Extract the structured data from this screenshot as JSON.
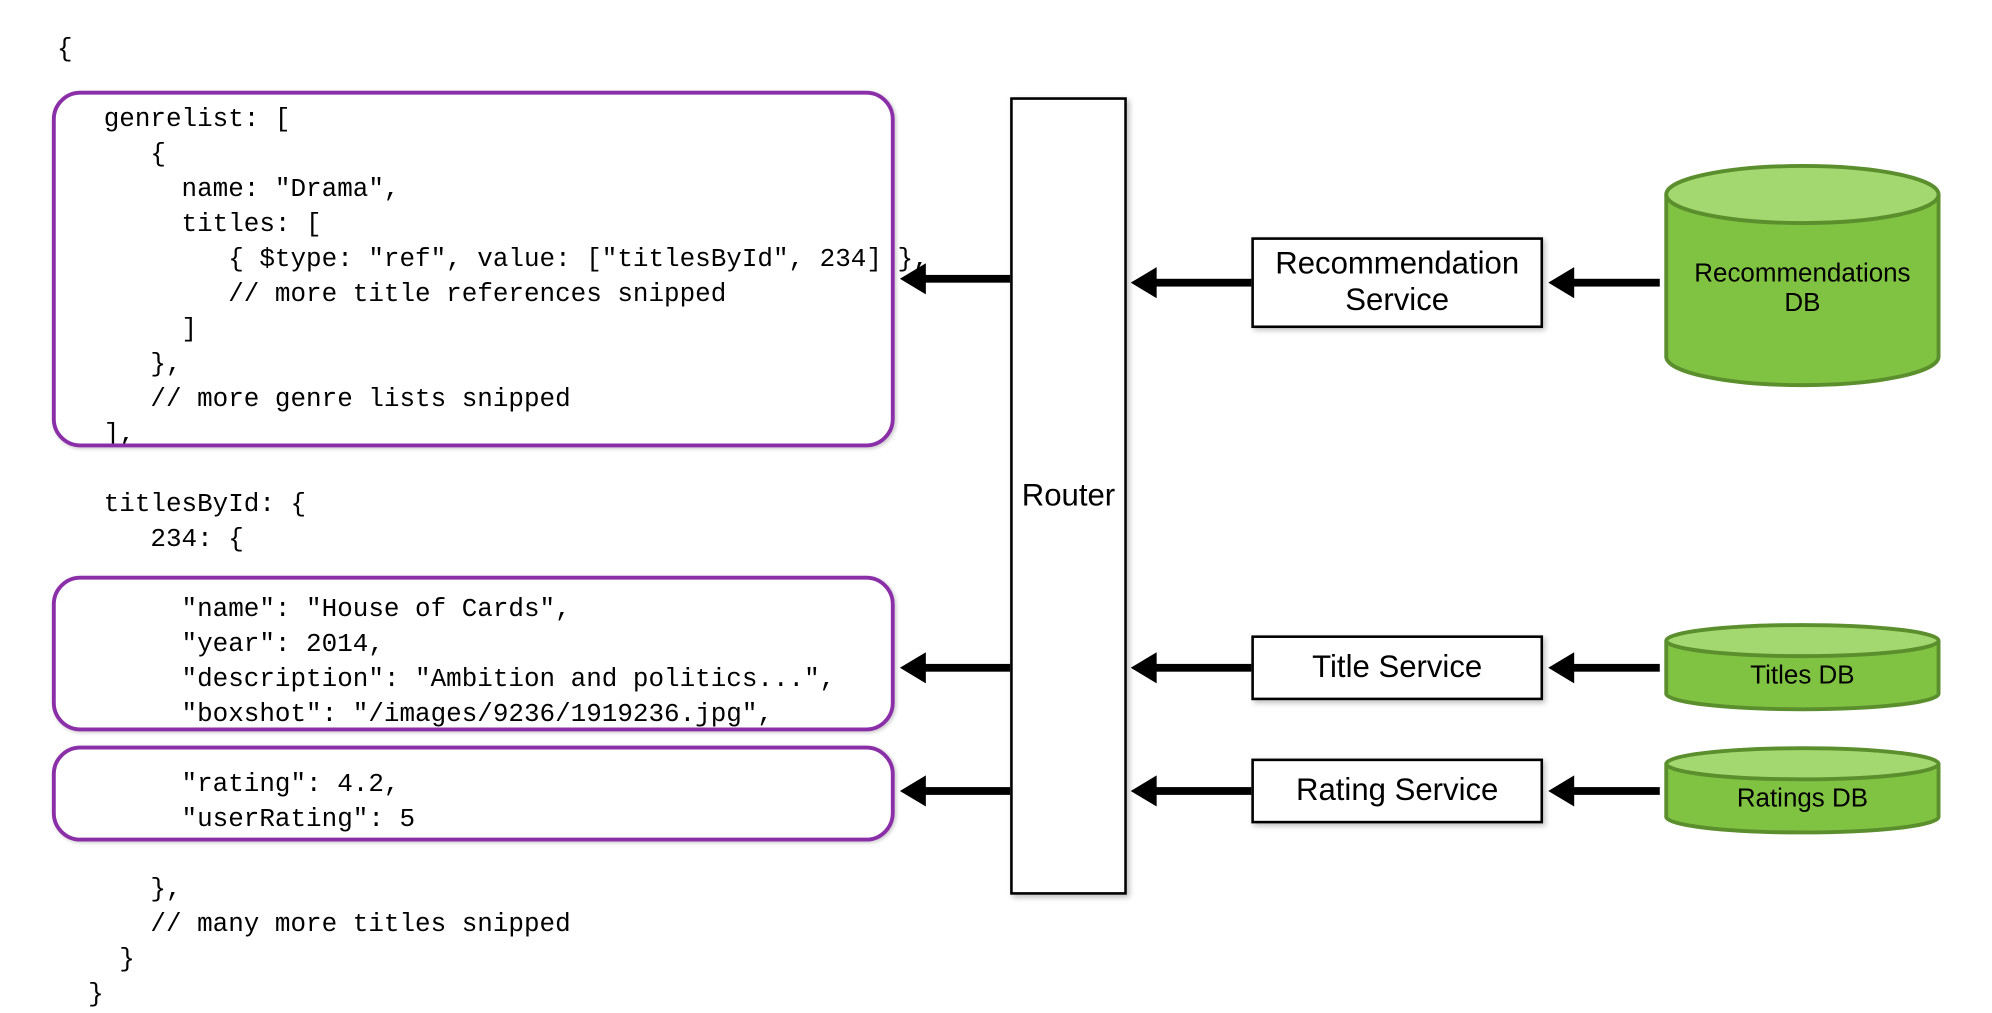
{
  "code_lines": [
    "{",
    "",
    "   genrelist: [",
    "      {",
    "        name: \"Drama\",",
    "        titles: [",
    "           { $type: \"ref\", value: [\"titlesById\", 234] },",
    "           // more title references snipped",
    "        ]",
    "      },",
    "      // more genre lists snipped",
    "   ],",
    "",
    "   titlesById: {",
    "      234: {",
    "",
    "        \"name\": \"House of Cards\",",
    "        \"year\": 2014,",
    "        \"description\": \"Ambition and politics...\",",
    "        \"boxshot\": \"/images/9236/1919236.jpg\",",
    "",
    "        \"rating\": 4.2,",
    "        \"userRating\": 5",
    "",
    "      },",
    "      // many more titles snipped",
    "    }",
    "  }"
  ],
  "router": {
    "label": "Router"
  },
  "services": {
    "recommendation": {
      "label": "Recommendation\nService"
    },
    "title": {
      "label": "Title Service"
    },
    "rating": {
      "label": "Rating Service"
    }
  },
  "databases": {
    "recommendations": {
      "label": "Recommendations\nDB"
    },
    "titles": {
      "label": "Titles DB"
    },
    "ratings": {
      "label": "Ratings DB"
    }
  },
  "colors": {
    "purple": "#8a2fa8",
    "db_fill": "#80c342",
    "db_top": "#a3d76f",
    "db_stroke": "#5b8f2d"
  }
}
